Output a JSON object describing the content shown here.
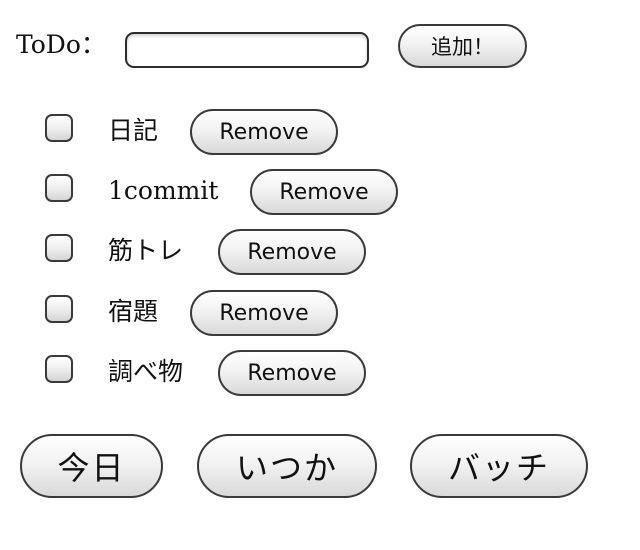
{
  "form": {
    "label": "ToDo：",
    "input_value": "",
    "input_placeholder": "",
    "add_button": "追加！"
  },
  "items": [
    {
      "text": "日記",
      "checked": false,
      "remove_label": "Remove"
    },
    {
      "text": "1commit",
      "checked": false,
      "remove_label": "Remove"
    },
    {
      "text": "筋トレ",
      "checked": false,
      "remove_label": "Remove"
    },
    {
      "text": "宿題",
      "checked": false,
      "remove_label": "Remove"
    },
    {
      "text": "調べ物",
      "checked": false,
      "remove_label": "Remove"
    }
  ],
  "nav": {
    "today": "今日",
    "someday": "いつか",
    "batch": "バッチ"
  }
}
